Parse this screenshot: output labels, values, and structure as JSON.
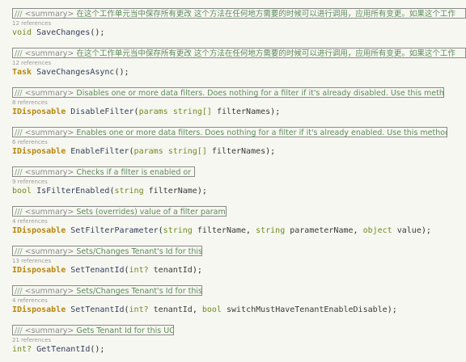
{
  "members": [
    {
      "slashes": "///",
      "summary_tag": "<summary>",
      "summary": "在这个工作单元当中保存所有更改 这个方法在任何地方需要的时候可以进行调用，应用所有变更。如果这个工作",
      "refs": "12 references",
      "return_type": "void",
      "name": "SaveChanges",
      "params": [],
      "suffix": "();"
    },
    {
      "slashes": "///",
      "summary_tag": "<summary>",
      "summary": "在这个工作单元当中保存所有更改 这个方法在任何地方需要的时候可以进行调用，应用所有变更。如果这个工作",
      "refs": "12 references",
      "return_type": "Task",
      "name": "SaveChangesAsync",
      "params": [],
      "suffix": "();"
    },
    {
      "slashes": "///",
      "summary_tag": "<summary>",
      "summary": "Disables one or more data filters. Does nothing for a filter if it's already disabled. Use this method in ...",
      "refs": "8 references",
      "return_type": "IDisposable",
      "name": "DisableFilter",
      "params": [
        {
          "kw": "params",
          "type": "string[]",
          "name": "filterNames"
        }
      ],
      "suffix": ");"
    },
    {
      "slashes": "///",
      "summary_tag": "<summary>",
      "summary": "Enables one or more data filters. Does nothing for a filter if it's already enabled. Use this method in a ...",
      "refs": "6 references",
      "return_type": "IDisposable",
      "name": "EnableFilter",
      "params": [
        {
          "kw": "params",
          "type": "string[]",
          "name": "filterNames"
        }
      ],
      "suffix": ");"
    },
    {
      "slashes": "///",
      "summary_tag": "<summary>",
      "summary": "Checks if a filter is enabled or not.",
      "refs": "9 references",
      "return_type": "bool",
      "name": "IsFilterEnabled",
      "params": [
        {
          "kw": "",
          "type": "string",
          "name": "filterName"
        }
      ],
      "suffix": ");"
    },
    {
      "slashes": "///",
      "summary_tag": "<summary>",
      "summary": "Sets (overrides) value of a filter parameter.",
      "refs": "4 references",
      "return_type": "IDisposable",
      "name": "SetFilterParameter",
      "params": [
        {
          "kw": "",
          "type": "string",
          "name": "filterName"
        },
        {
          "kw": "",
          "type": "string",
          "name": "parameterName"
        },
        {
          "kw": "",
          "type": "object",
          "name": "value"
        }
      ],
      "suffix": ");"
    },
    {
      "slashes": "///",
      "summary_tag": "<summary>",
      "summary": "Sets/Changes Tenant's Id for this UOW.",
      "refs": "13 references",
      "return_type": "IDisposable",
      "name": "SetTenantId",
      "params": [
        {
          "kw": "",
          "type": "int?",
          "name": "tenantId"
        }
      ],
      "suffix": ");"
    },
    {
      "slashes": "///",
      "summary_tag": "<summary>",
      "summary": "Sets/Changes Tenant's Id for this UOW.",
      "refs": "4 references",
      "return_type": "IDisposable",
      "name": "SetTenantId",
      "params": [
        {
          "kw": "",
          "type": "int?",
          "name": "tenantId"
        },
        {
          "kw": "",
          "type": "bool",
          "name": "switchMustHaveTenantEnableDisable"
        }
      ],
      "suffix": ");"
    },
    {
      "slashes": "///",
      "summary_tag": "<summary>",
      "summary": "Gets Tenant Id for this UOW.",
      "refs": "21 references",
      "return_type": "int?",
      "name": "GetTenantId",
      "params": [],
      "suffix": "();"
    }
  ]
}
